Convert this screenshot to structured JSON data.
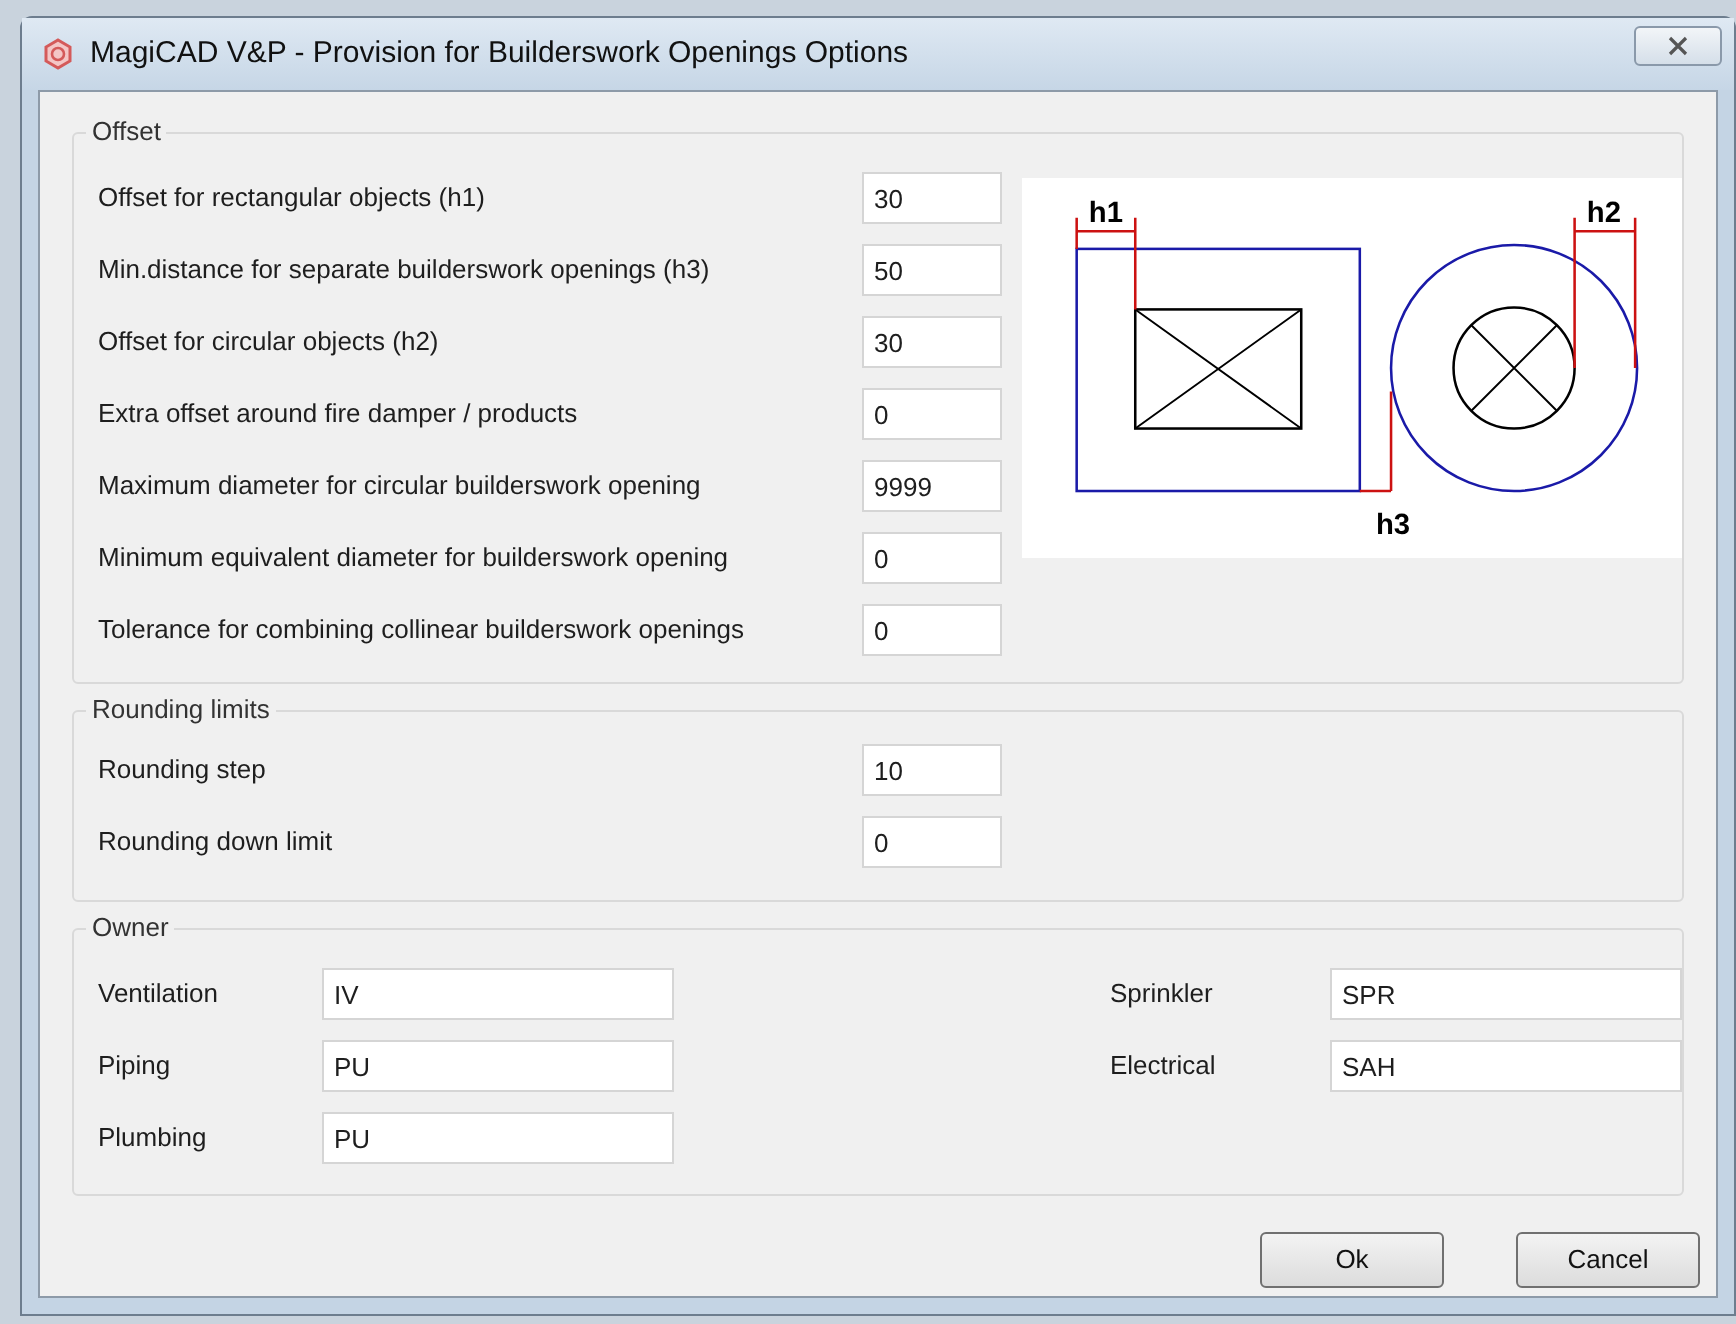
{
  "window": {
    "title": "MagiCAD V&P - Provision for Builderswork Openings Options"
  },
  "offset": {
    "title": "Offset",
    "fields": [
      {
        "label": "Offset for rectangular objects (h1)",
        "value": "30"
      },
      {
        "label": "Min.distance for separate builderswork openings (h3)",
        "value": "50"
      },
      {
        "label": "Offset for circular objects (h2)",
        "value": "30"
      },
      {
        "label": "Extra offset around fire damper / products",
        "value": "0"
      },
      {
        "label": "Maximum diameter for circular builderswork opening",
        "value": "9999"
      },
      {
        "label": "Minimum equivalent diameter for builderswork opening",
        "value": "0"
      },
      {
        "label": "Tolerance for combining collinear builderswork openings",
        "value": "0"
      }
    ],
    "diagram": {
      "labels": [
        "h1",
        "h2",
        "h3"
      ]
    }
  },
  "rounding": {
    "title": "Rounding limits",
    "fields": [
      {
        "label": "Rounding step",
        "value": "10"
      },
      {
        "label": "Rounding down limit",
        "value": "0"
      }
    ]
  },
  "owner": {
    "title": "Owner",
    "left": [
      {
        "label": "Ventilation",
        "value": "IV"
      },
      {
        "label": "Piping",
        "value": "PU"
      },
      {
        "label": "Plumbing",
        "value": "PU"
      }
    ],
    "right": [
      {
        "label": "Sprinkler",
        "value": "SPR"
      },
      {
        "label": "Electrical",
        "value": "SAH"
      }
    ]
  },
  "buttons": [
    "Ok",
    "Cancel"
  ]
}
